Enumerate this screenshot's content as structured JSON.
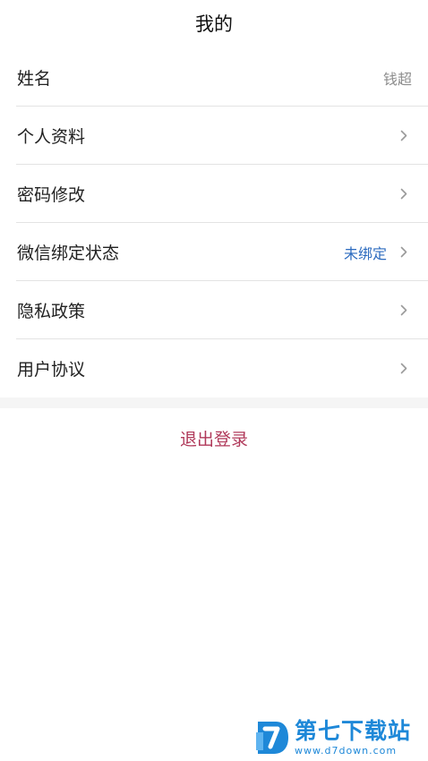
{
  "header": {
    "title": "我的"
  },
  "profile": {
    "name_label": "姓名",
    "name_value": "钱超"
  },
  "menu": [
    {
      "label": "个人资料"
    },
    {
      "label": "密码修改"
    },
    {
      "label": "微信绑定状态",
      "status": "未绑定"
    },
    {
      "label": "隐私政策"
    },
    {
      "label": "用户协议"
    }
  ],
  "logout_label": "退出登录",
  "watermark": {
    "brand": "第七下载站",
    "url": "www.d7down.com"
  },
  "colors": {
    "status_blue": "#2c6bbf",
    "logout_red": "#b0395a",
    "watermark_blue": "#1e88d8"
  },
  "icons": [
    "chevron-right-icon",
    "d7-logo"
  ]
}
